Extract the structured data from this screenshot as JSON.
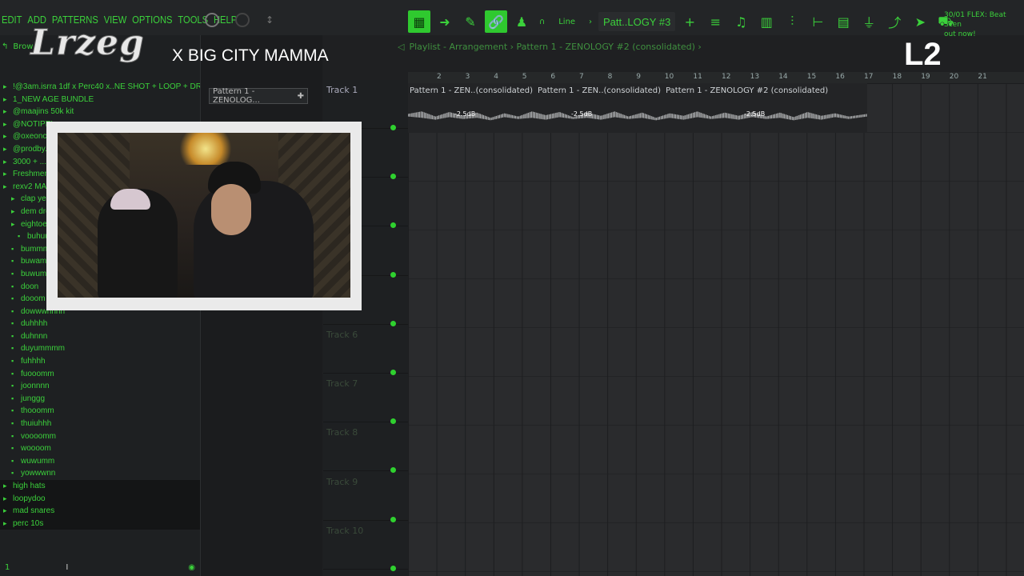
{
  "overlay": {
    "logo_text": "Lrzeg",
    "stream_title": "X BIG CITY MAMMA",
    "level_badge": "L2"
  },
  "menu": [
    "EDIT",
    "ADD",
    "PATTERNS",
    "VIEW",
    "OPTIONS",
    "TOOLS",
    "HELP"
  ],
  "toolbar": {
    "snap_label": "Line",
    "pattern_selector": "Patt..LOGY #3",
    "promo_line1": "30/01  FLEX: Beat Scen",
    "promo_line2": "out now!"
  },
  "browser": {
    "header_label": "Brow",
    "items": [
      {
        "label": "!@3am.isrra 1df x Perc40 x..NE SHOT + LOOP + DRUMKIT!",
        "icon": "folder-icon",
        "style": "top"
      },
      {
        "label": "1_NEW AGE BUNDLE",
        "icon": "folder-icon",
        "style": "top"
      },
      {
        "label": "@maajins 50k kit",
        "icon": "folder-icon",
        "style": "top"
      },
      {
        "label": "@NOTIPEL...",
        "icon": "folder-icon",
        "style": "top"
      },
      {
        "label": "@oxeonce...",
        "icon": "folder-icon",
        "style": "top"
      },
      {
        "label": "@prodby...",
        "icon": "folder-icon",
        "style": "top"
      },
      {
        "label": "3000 + ...",
        "icon": "folder-icon",
        "style": "top"
      },
      {
        "label": "Freshmen...",
        "icon": "folder-icon",
        "style": "top"
      },
      {
        "label": "rexv2 MAN...",
        "icon": "folder-icon",
        "style": "top"
      },
      {
        "label": "clap yeah",
        "icon": "folder-icon",
        "style": "sub"
      },
      {
        "label": "dem dro...",
        "icon": "folder-icon",
        "style": "sub"
      },
      {
        "label": "eightoe...",
        "icon": "folder-icon",
        "style": "sub"
      },
      {
        "label": "buhuuu",
        "icon": "file-icon",
        "style": "indent"
      },
      {
        "label": "bummmm",
        "icon": "file-icon",
        "style": "sub"
      },
      {
        "label": "buwam",
        "icon": "file-icon",
        "style": "sub"
      },
      {
        "label": "buwumm",
        "icon": "file-icon",
        "style": "sub"
      },
      {
        "label": "doon",
        "icon": "file-icon",
        "style": "sub"
      },
      {
        "label": "dooom",
        "icon": "file-icon",
        "style": "sub"
      },
      {
        "label": "dowwwnnnn",
        "icon": "file-icon",
        "style": "sub"
      },
      {
        "label": "duhhhh",
        "icon": "file-icon",
        "style": "sub"
      },
      {
        "label": "duhnnn",
        "icon": "file-icon",
        "style": "sub"
      },
      {
        "label": "duyummmm",
        "icon": "file-icon",
        "style": "sub"
      },
      {
        "label": "fuhhhh",
        "icon": "file-icon",
        "style": "sub"
      },
      {
        "label": "fuooomm",
        "icon": "file-icon",
        "style": "sub"
      },
      {
        "label": "joonnnn",
        "icon": "file-icon",
        "style": "sub"
      },
      {
        "label": "junggg",
        "icon": "file-icon",
        "style": "sub"
      },
      {
        "label": "thooomm",
        "icon": "file-icon",
        "style": "sub"
      },
      {
        "label": "thuiuhhh",
        "icon": "file-icon",
        "style": "sub"
      },
      {
        "label": "voooomm",
        "icon": "file-icon",
        "style": "sub"
      },
      {
        "label": "woooom",
        "icon": "file-icon",
        "style": "sub"
      },
      {
        "label": "wuwumm",
        "icon": "file-icon",
        "style": "sub"
      },
      {
        "label": "yowwwnn",
        "icon": "file-icon",
        "style": "sub"
      },
      {
        "label": "high hats",
        "icon": "folder-icon",
        "style": "dark"
      },
      {
        "label": "loopydoo",
        "icon": "folder-icon",
        "style": "dark"
      },
      {
        "label": "mad snares",
        "icon": "folder-icon",
        "style": "dark"
      },
      {
        "label": "perc 10s",
        "icon": "folder-icon",
        "style": "dark"
      }
    ],
    "footer_left": "1"
  },
  "picker": {
    "pattern_item": "Pattern 1 - ZENOLOG..."
  },
  "playlist": {
    "title": "Playlist - Arrangement › Pattern 1 - ZENOLOGY #2 (consolidated) ›",
    "ruler": [
      "2",
      "3",
      "4",
      "5",
      "6",
      "7",
      "8",
      "9",
      "10",
      "11",
      "12",
      "13",
      "14",
      "15",
      "16",
      "17",
      "18",
      "19",
      "20",
      "21"
    ],
    "clip_labels": [
      "Pattern 1 - ZEN..(consolidated)",
      "Pattern 1 - ZEN..(consolidated)",
      "Pattern 1 - ZENOLOGY #2 (consolidated)"
    ],
    "clip_db": [
      "-2.5dB",
      "-2.5dB",
      "-2.5dB"
    ],
    "tracks": [
      "Track 1",
      "",
      "",
      "",
      "",
      "Track 6",
      "Track 7",
      "Track 8",
      "Track 9",
      "Track 10"
    ]
  },
  "colors": {
    "accent": "#3bd13b",
    "background": "#1f2022",
    "grid_cell": "#2a2b2d"
  }
}
